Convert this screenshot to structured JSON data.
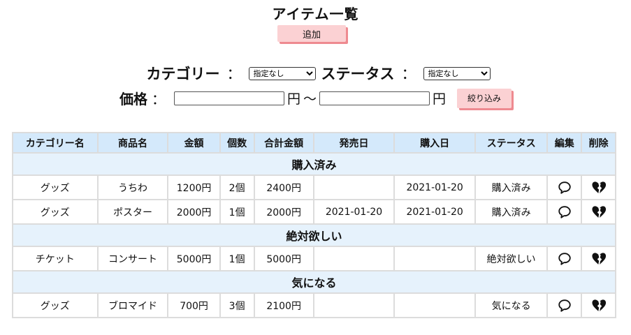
{
  "page": {
    "title": "アイテム一覧"
  },
  "toolbar": {
    "add_label": "追加"
  },
  "filters": {
    "category_label": "カテゴリー",
    "status_label": "ステータス",
    "colon": "：",
    "category_selected": "指定なし",
    "status_selected": "指定なし",
    "price_label": "価格",
    "price_min": "",
    "price_max": "",
    "yen": "円",
    "range_sep": "〜",
    "submit_label": "絞り込み"
  },
  "table": {
    "headers": [
      "カテゴリー名",
      "商品名",
      "金額",
      "個数",
      "合計金額",
      "発売日",
      "購入日",
      "ステータス",
      "編集",
      "削除"
    ],
    "groups": [
      {
        "name": "購入済み",
        "rows": [
          {
            "category": "グッズ",
            "name": "うちわ",
            "price": "1200円",
            "qty": "2個",
            "total": "2400円",
            "release": "",
            "purchase": "2021-01-20",
            "status": "購入済み"
          },
          {
            "category": "グッズ",
            "name": "ポスター",
            "price": "2000円",
            "qty": "1個",
            "total": "2000円",
            "release": "2021-01-20",
            "purchase": "2021-01-20",
            "status": "購入済み"
          }
        ]
      },
      {
        "name": "絶対欲しい",
        "rows": [
          {
            "category": "チケット",
            "name": "コンサート",
            "price": "5000円",
            "qty": "1個",
            "total": "5000円",
            "release": "",
            "purchase": "",
            "status": "絶対欲しい"
          }
        ]
      },
      {
        "name": "気になる",
        "rows": [
          {
            "category": "グッズ",
            "name": "ブロマイド",
            "price": "700円",
            "qty": "3個",
            "total": "2100円",
            "release": "",
            "purchase": "",
            "status": "気になる"
          }
        ]
      }
    ]
  },
  "icons": {
    "edit": "speech-bubble-icon",
    "delete": "broken-heart-icon"
  },
  "colors": {
    "header_bg": "#d4e9fb",
    "group_bg": "#e6f2fc",
    "button_bg": "#fbd1d3",
    "button_shadow": "#ee8a90"
  }
}
